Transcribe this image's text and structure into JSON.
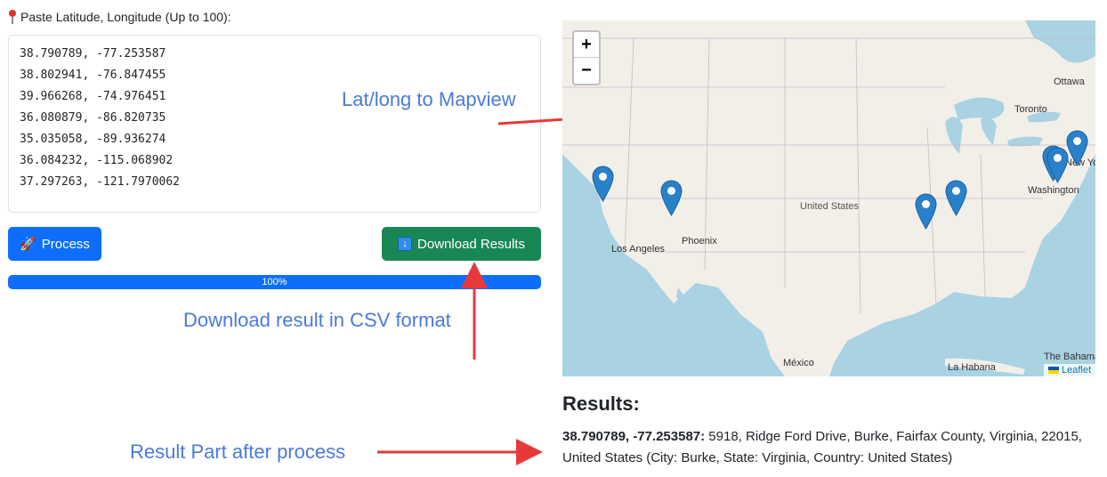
{
  "input": {
    "label": "Paste Latitude, Longitude (Up to 100):",
    "coordinates": [
      "38.790789, -77.253587",
      "38.802941, -76.847455",
      "39.966268, -74.976451",
      "36.080879, -86.820735",
      "35.035058, -89.936274",
      "36.084232, -115.068902",
      "37.297263, -121.7970062"
    ]
  },
  "buttons": {
    "process_label": "Process",
    "download_label": "Download Results"
  },
  "progress": {
    "value": 1.0,
    "label": "100%"
  },
  "annotations": {
    "map": "Lat/long to Mapview",
    "csv": "Download result in CSV format",
    "result": "Result Part after process"
  },
  "map": {
    "labels": {
      "ottawa": "Ottawa",
      "toronto": "Toronto",
      "new_york": "New York",
      "washington": "Washington",
      "united_states": "United States",
      "phoenix": "Phoenix",
      "los_angeles": "Los Angeles",
      "mexico": "México",
      "la_habana": "La Habana",
      "bahamas": "The Bahamas"
    },
    "attribution": "Leaflet",
    "zoom_in": "+",
    "zoom_out": "−",
    "marker_color": "#2a81cb"
  },
  "results": {
    "title": "Results:",
    "items": [
      {
        "coords": "38.790789, -77.253587:",
        "address": " 5918, Ridge Ford Drive, Burke, Fairfax County, Virginia, 22015, United States (City: Burke, State: Virginia, Country: United States)"
      }
    ]
  },
  "colors": {
    "primary": "#0d6efd",
    "success": "#198754",
    "annotation": "#4a7ad8",
    "arrow": "#e8393a"
  }
}
